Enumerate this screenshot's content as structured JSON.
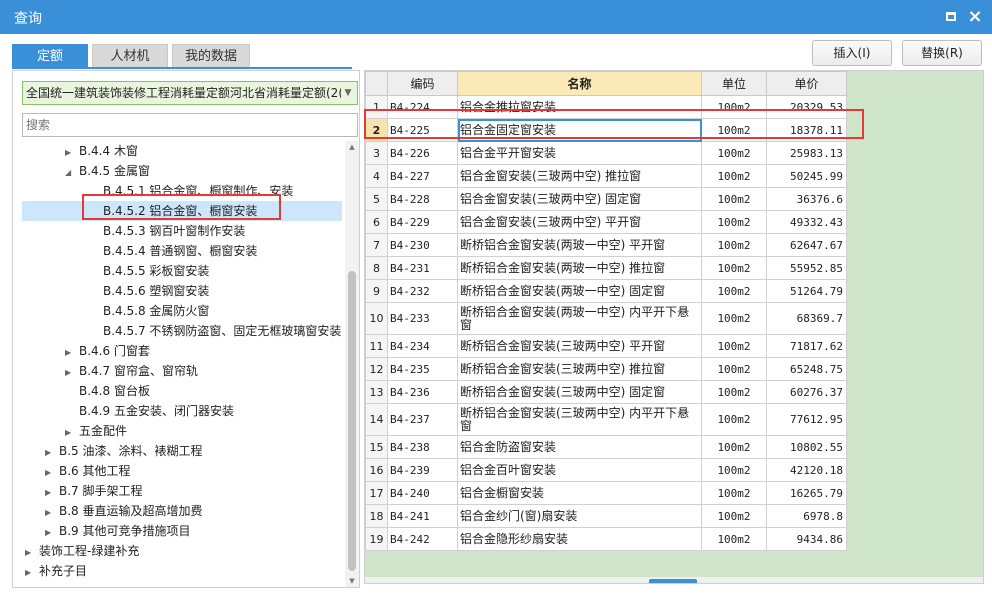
{
  "window": {
    "title": "查询"
  },
  "tabs": [
    {
      "label": "定额",
      "active": true
    },
    {
      "label": "人材机",
      "active": false
    },
    {
      "label": "我的数据",
      "active": false
    }
  ],
  "actions": {
    "insert_label": "插入(I)",
    "replace_label": "替换(R)"
  },
  "library_select": {
    "value": "全国统一建筑装饰装修工程消耗量定额河北省消耗量定额(2("
  },
  "search": {
    "placeholder": "搜索"
  },
  "tree": [
    {
      "label": "B.4.4 木窗",
      "toggle": "▶"
    },
    {
      "label": "B.4.5 金属窗",
      "toggle": "◢"
    },
    {
      "label": "B.4.5.1 铝合金窗、橱窗制作、安装",
      "toggle": ""
    },
    {
      "label": "B.4.5.2 铝合金窗、橱窗安装",
      "toggle": "",
      "selected": true
    },
    {
      "label": "B.4.5.3 钢百叶窗制作安装",
      "toggle": ""
    },
    {
      "label": "B.4.5.4 普通钢窗、橱窗安装",
      "toggle": ""
    },
    {
      "label": "B.4.5.5 彩板窗安装",
      "toggle": ""
    },
    {
      "label": "B.4.5.6 塑钢窗安装",
      "toggle": ""
    },
    {
      "label": "B.4.5.8 金属防火窗",
      "toggle": ""
    },
    {
      "label": "B.4.5.7 不锈钢防盗窗、固定无框玻璃窗安装",
      "toggle": ""
    },
    {
      "label": "B.4.6 门窗套",
      "toggle": "▶"
    },
    {
      "label": "B.4.7 窗帘盒、窗帘轨",
      "toggle": "▶"
    },
    {
      "label": "B.4.8 窗台板",
      "toggle": ""
    },
    {
      "label": "B.4.9 五金安装、闭门器安装",
      "toggle": ""
    },
    {
      "label": "五金配件",
      "toggle": "▶"
    },
    {
      "label": "B.5 油漆、涂料、裱糊工程",
      "toggle": "▶"
    },
    {
      "label": "B.6 其他工程",
      "toggle": "▶"
    },
    {
      "label": "B.7 脚手架工程",
      "toggle": "▶"
    },
    {
      "label": "B.8 垂直运输及超高增加费",
      "toggle": "▶"
    },
    {
      "label": "B.9 其他可竞争措施项目",
      "toggle": "▶"
    },
    {
      "label": "装饰工程-绿建补充",
      "toggle": "▶"
    },
    {
      "label": "补充子目",
      "toggle": "▶"
    }
  ],
  "table": {
    "columns": [
      "编码",
      "名称",
      "单位",
      "单价"
    ],
    "rows": [
      {
        "idx": "1",
        "code": "B4-224",
        "name": "铝合金推拉窗安装",
        "unit": "100m2",
        "price": "20329.53"
      },
      {
        "idx": "2",
        "code": "B4-225",
        "name": "铝合金固定窗安装",
        "unit": "100m2",
        "price": "18378.11",
        "current": true
      },
      {
        "idx": "3",
        "code": "B4-226",
        "name": "铝合金平开窗安装",
        "unit": "100m2",
        "price": "25983.13"
      },
      {
        "idx": "4",
        "code": "B4-227",
        "name": "铝合金窗安装(三玻两中空) 推拉窗",
        "unit": "100m2",
        "price": "50245.99"
      },
      {
        "idx": "5",
        "code": "B4-228",
        "name": "铝合金窗安装(三玻两中空) 固定窗",
        "unit": "100m2",
        "price": "36376.6"
      },
      {
        "idx": "6",
        "code": "B4-229",
        "name": "铝合金窗安装(三玻两中空) 平开窗",
        "unit": "100m2",
        "price": "49332.43"
      },
      {
        "idx": "7",
        "code": "B4-230",
        "name": "断桥铝合金窗安装(两玻一中空) 平开窗",
        "unit": "100m2",
        "price": "62647.67"
      },
      {
        "idx": "8",
        "code": "B4-231",
        "name": "断桥铝合金窗安装(两玻一中空) 推拉窗",
        "unit": "100m2",
        "price": "55952.85"
      },
      {
        "idx": "9",
        "code": "B4-232",
        "name": "断桥铝合金窗安装(两玻一中空) 固定窗",
        "unit": "100m2",
        "price": "51264.79"
      },
      {
        "idx": "10",
        "code": "B4-233",
        "name": "断桥铝合金窗安装(两玻一中空) 内平开下悬窗",
        "unit": "100m2",
        "price": "68369.7"
      },
      {
        "idx": "11",
        "code": "B4-234",
        "name": "断桥铝合金窗安装(三玻两中空) 平开窗",
        "unit": "100m2",
        "price": "71817.62"
      },
      {
        "idx": "12",
        "code": "B4-235",
        "name": "断桥铝合金窗安装(三玻两中空) 推拉窗",
        "unit": "100m2",
        "price": "65248.75"
      },
      {
        "idx": "13",
        "code": "B4-236",
        "name": "断桥铝合金窗安装(三玻两中空) 固定窗",
        "unit": "100m2",
        "price": "60276.37"
      },
      {
        "idx": "14",
        "code": "B4-237",
        "name": "断桥铝合金窗安装(三玻两中空) 内平开下悬窗",
        "unit": "100m2",
        "price": "77612.95"
      },
      {
        "idx": "15",
        "code": "B4-238",
        "name": "铝合金防盗窗安装",
        "unit": "100m2",
        "price": "10802.55"
      },
      {
        "idx": "16",
        "code": "B4-239",
        "name": "铝合金百叶窗安装",
        "unit": "100m2",
        "price": "42120.18"
      },
      {
        "idx": "17",
        "code": "B4-240",
        "name": "铝合金橱窗安装",
        "unit": "100m2",
        "price": "16265.79"
      },
      {
        "idx": "18",
        "code": "B4-241",
        "name": "铝合金纱门(窗)扇安装",
        "unit": "100m2",
        "price": "6978.8"
      },
      {
        "idx": "19",
        "code": "B4-242",
        "name": "铝合金隐形纱扇安装",
        "unit": "100m2",
        "price": "9434.86"
      }
    ]
  },
  "colors": {
    "accent": "#3a8fd9",
    "highlight_border": "#e53935",
    "grid_bg": "#cfe5c9",
    "selected_tree": "#cce6fb"
  }
}
